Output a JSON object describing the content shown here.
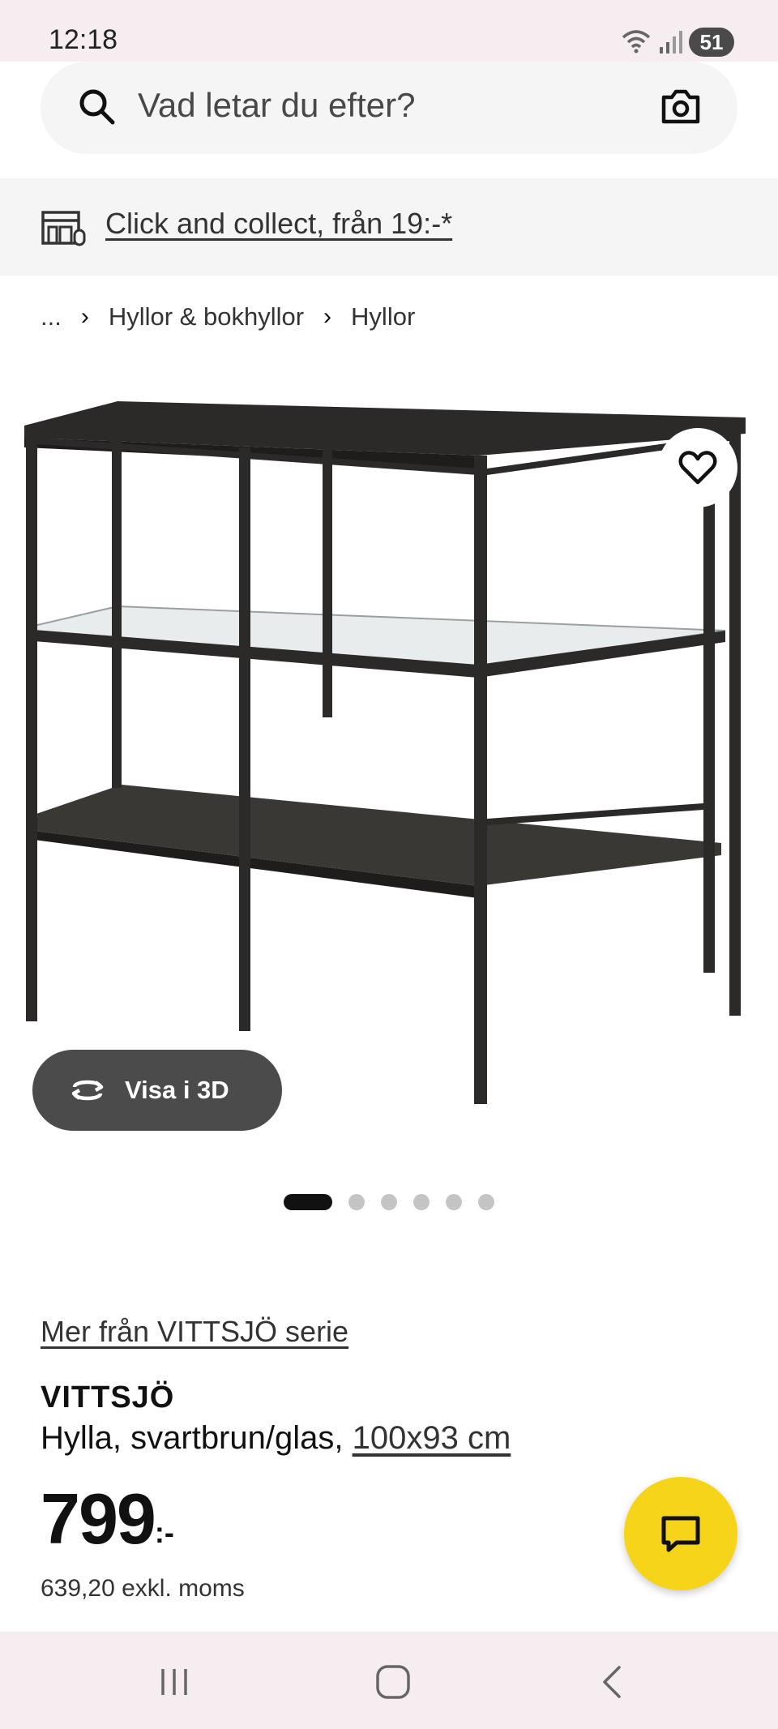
{
  "status_bar": {
    "time": "12:18",
    "battery": "51"
  },
  "search": {
    "placeholder": "Vad letar du efter?"
  },
  "banner": {
    "click_collect": "Click and collect, från 19:-*"
  },
  "breadcrumb": {
    "items": [
      "...",
      "Hyllor & bokhyllor",
      "Hyllor"
    ]
  },
  "gallery": {
    "visa3d_label": "Visa i 3D",
    "slide_count": 6,
    "active_slide": 1
  },
  "product": {
    "series_link": "Mer från VITTSJÖ serie",
    "name": "VITTSJÖ",
    "description": "Hylla, svartbrun/glas,",
    "size": "100x93 cm",
    "price": "799",
    "price_suffix": ":-",
    "price_ex_vat": "639,20 exkl. moms"
  },
  "colors": {
    "accent_yellow": "#f5d41a",
    "dark_button": "#4b4b4b",
    "frame": "#2b2a28"
  }
}
